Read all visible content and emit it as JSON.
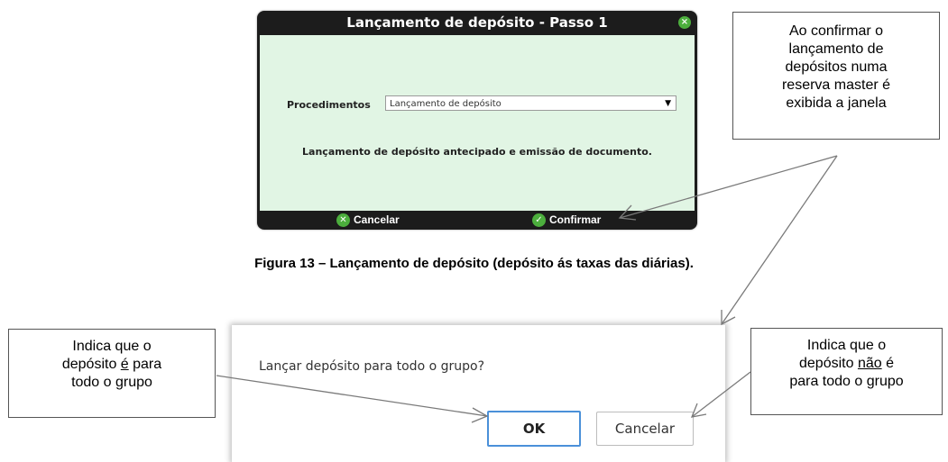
{
  "dialog1": {
    "title": "Lançamento de depósito - Passo 1",
    "close_glyph": "×",
    "procedures_label": "Procedimentos",
    "procedures_value": "Lançamento de depósito",
    "select_arrow": "▼",
    "description": "Lançamento de depósito antecipado e emissão de documento.",
    "cancel_label": "Cancelar",
    "confirm_label": "Confirmar",
    "cancel_icon": "close-icon",
    "confirm_icon": "check-icon",
    "accent_color": "#4cae3d",
    "body_color": "#e1f5e4"
  },
  "caption": "Figura 13 – Lançamento de depósito (depósito ás taxas das diárias).",
  "callouts": {
    "top_right": [
      "Ao confirmar o",
      "lançamento de",
      "depósitos numa",
      "reserva master é",
      "exibida a janela"
    ],
    "left": {
      "line1": "Indica que o",
      "line2_pre": "depósito ",
      "line2_underlined": "é",
      "line2_post": " para",
      "line3": "todo o grupo"
    },
    "right": {
      "line1": "Indica que o",
      "line2_pre": "depósito ",
      "line2_underlined": "não",
      "line2_post": " é",
      "line3": "para todo o grupo"
    }
  },
  "dialog2": {
    "message": "Lançar depósito para todo o grupo?",
    "ok_label": "OK",
    "cancel_label": "Cancelar",
    "ok_border_color": "#4a90d9"
  }
}
